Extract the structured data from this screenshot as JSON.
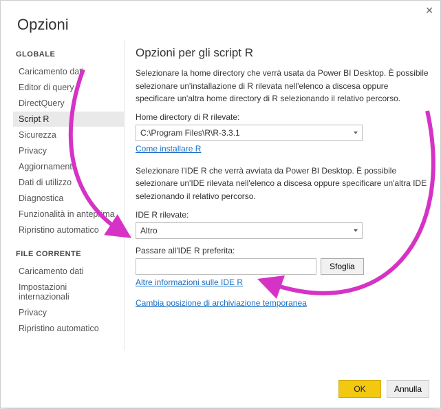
{
  "window": {
    "title": "Opzioni",
    "close_glyph": "✕"
  },
  "sidebar": {
    "section1": "GLOBALE",
    "section2": "FILE CORRENTE",
    "global_items": [
      "Caricamento dati",
      "Editor di query",
      "DirectQuery",
      "Script R",
      "Sicurezza",
      "Privacy",
      "Aggiornamenti",
      "Dati di utilizzo",
      "Diagnostica",
      "Funzionalità in anteprima",
      "Ripristino automatico"
    ],
    "selected_index": 3,
    "file_items": [
      "Caricamento dati",
      "Impostazioni internazionali",
      "Privacy",
      "Ripristino automatico"
    ]
  },
  "main": {
    "heading": "Opzioni per gli script R",
    "para1": "Selezionare la home directory che verrà usata da Power BI Desktop. È possibile selezionare un'installazione di R rilevata nell'elenco a discesa oppure specificare un'altra home directory di R selezionando il relativo percorso.",
    "home_label": "Home directory di R rilevate:",
    "home_value": "C:\\Program Files\\R\\R-3.3.1",
    "install_link": "Come installare R",
    "para2": "Selezionare l'IDE R che verrà avviata da Power BI Desktop. È possibile selezionare un'IDE rilevata nell'elenco a discesa oppure specificare un'altra IDE selezionando il relativo percorso.",
    "ide_label": "IDE R rilevate:",
    "ide_value": "Altro",
    "pref_label": "Passare all'IDE R preferita:",
    "pref_value": "",
    "browse_label": "Sfoglia",
    "ide_info_link": "Altre informazioni sulle IDE R",
    "temp_link": "Cambia posizione di archiviazione temporanea"
  },
  "footer": {
    "ok": "OK",
    "cancel": "Annulla"
  },
  "colors": {
    "accent": "#f2c811",
    "annotation": "#d633c6"
  }
}
